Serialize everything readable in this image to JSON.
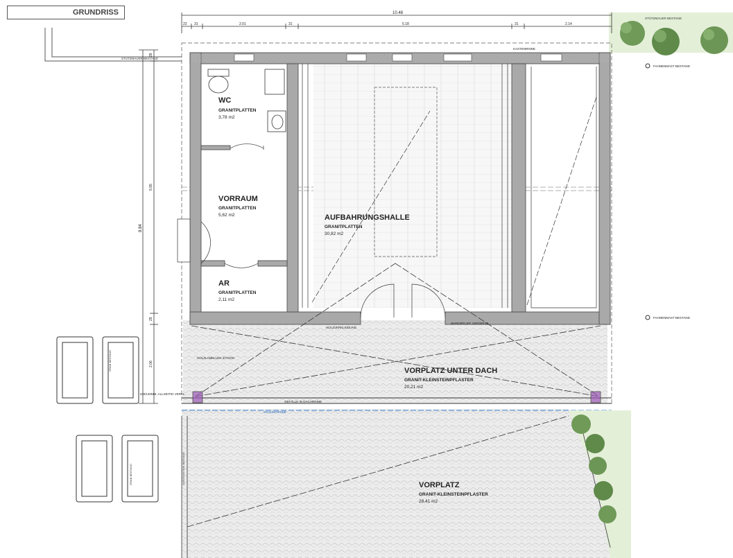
{
  "sheet": {
    "title": "GRUNDRISS"
  },
  "dimensions": {
    "top": [
      "22",
      "31",
      "2.01",
      "31",
      "5.18",
      "31",
      "2.14"
    ],
    "total_width": "10.48",
    "left": [
      "29",
      "5.95",
      "29",
      "2.06"
    ],
    "total_depth": "8.84"
  },
  "rooms": {
    "wc": {
      "name": "WC",
      "material": "GRANITPLATTEN",
      "area": "3,78 m2"
    },
    "vorraum": {
      "name": "VORRAUM",
      "material": "GRANITPLATTEN",
      "area": "5,62 m2"
    },
    "ar": {
      "name": "AR",
      "material": "GRANITPLATTEN",
      "area": "2,11 m2"
    },
    "halle": {
      "name": "AUFBAHRUNGSHALLE",
      "material": "GRANITPLATTEN",
      "area": "30,82 m2"
    },
    "vorplatz_dach": {
      "name": "VORPLATZ UNTER DACH",
      "material": "GRANIT-KLEINSTEINPFLASTER",
      "area": "20,21 m2"
    },
    "vorplatz": {
      "name": "VORPLATZ",
      "material": "GRANIT-KLEINSTEINPFLASTER",
      "area": "28,41 m2"
    }
  },
  "annotations": {
    "stuetzmauer_left": "STÜTZMAUER BESTAND",
    "stuetzmauer_right": "STÜTZMAUER BESTAND",
    "fahnenmast_top": "FAHNENMAST BESTAND",
    "fahnenmast_bottom": "FAHNENMAST BESTAND",
    "kastenrinne": "KASTENRINNE",
    "gefaelle": "GEFÄLLE IN DACHRINNE",
    "schleifrinne": "SCHLEIFRINNE",
    "holzverleidung": "HOLZVERKLEIDUNG",
    "stahlstuetze": "STAHLSTÜTZE CA. 100/140MM, ALLSEITIG VERKL.",
    "grab_bestand": "GRAB BESTAND",
    "leistenstein": "LEISTENSTEIN BESTAND",
    "wandrelief": "WANDRELIEF 180/200CM",
    "holzlamellen": "HOLZLAMELLEN 4/7/4CM"
  },
  "colors": {
    "wall": "#a9a9a9",
    "line": "#3a3a3a",
    "paving": "#e9e9e9",
    "tree": "#5f8a4a",
    "lawn": "#cfe2bf",
    "drain": "#3b7fd0",
    "column": "#9b59b6"
  }
}
